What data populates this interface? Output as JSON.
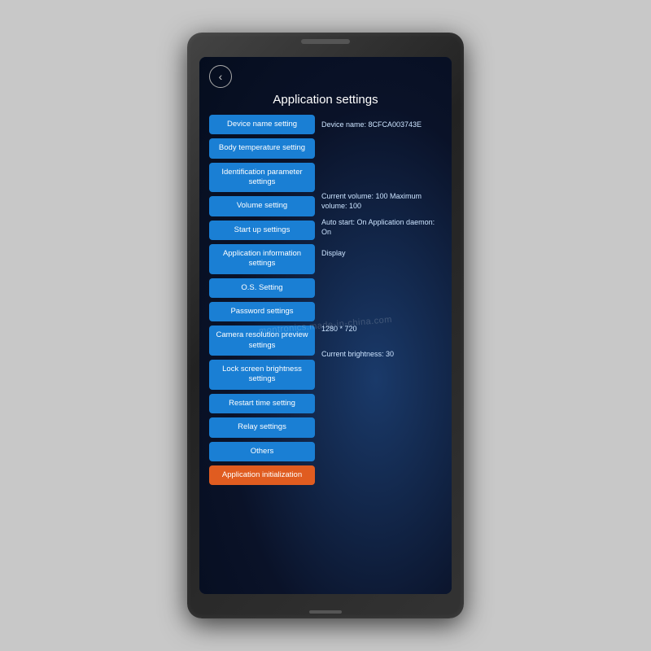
{
  "device": {
    "label": "tablet-device"
  },
  "screen": {
    "title": "Application settings",
    "back_icon": "‹",
    "watermark": "montronics.made-in-china.com"
  },
  "buttons": [
    {
      "id": "device-name-setting",
      "label": "Device name setting",
      "variant": "blue"
    },
    {
      "id": "body-temp-setting",
      "label": "Body temperature setting",
      "variant": "blue"
    },
    {
      "id": "identification-param",
      "label": "Identification parameter settings",
      "variant": "blue"
    },
    {
      "id": "volume-setting",
      "label": "Volume setting",
      "variant": "blue"
    },
    {
      "id": "startup-settings",
      "label": "Start up settings",
      "variant": "blue"
    },
    {
      "id": "app-info-settings",
      "label": "Application information settings",
      "variant": "blue"
    },
    {
      "id": "os-setting",
      "label": "O.S. Setting",
      "variant": "blue"
    },
    {
      "id": "password-settings",
      "label": "Password settings",
      "variant": "blue"
    },
    {
      "id": "camera-resolution",
      "label": "Camera resolution preview settings",
      "variant": "blue"
    },
    {
      "id": "lock-screen-brightness",
      "label": "Lock screen brightness settings",
      "variant": "blue"
    },
    {
      "id": "restart-time",
      "label": "Restart time setting",
      "variant": "blue"
    },
    {
      "id": "relay-settings",
      "label": "Relay settings",
      "variant": "blue"
    },
    {
      "id": "others",
      "label": "Others",
      "variant": "blue"
    },
    {
      "id": "app-initialization",
      "label": "Application initialization",
      "variant": "orange"
    }
  ],
  "info_rows": [
    {
      "id": "device-name-info",
      "text": "Device name: 8CFCA003743E"
    },
    {
      "id": "body-temp-info",
      "text": ""
    },
    {
      "id": "identification-info",
      "text": ""
    },
    {
      "id": "volume-info",
      "text": "Current volume: 100     Maximum volume: 100"
    },
    {
      "id": "startup-info",
      "text": "Auto start: On     Application  daemon: On"
    },
    {
      "id": "app-info-display",
      "text": "Display"
    },
    {
      "id": "os-info",
      "text": ""
    },
    {
      "id": "password-info",
      "text": ""
    },
    {
      "id": "camera-info",
      "text": "1280 * 720"
    },
    {
      "id": "brightness-info",
      "text": "Current brightness: 30"
    },
    {
      "id": "restart-info",
      "text": ""
    },
    {
      "id": "relay-info",
      "text": ""
    },
    {
      "id": "others-info",
      "text": ""
    },
    {
      "id": "init-info",
      "text": ""
    }
  ]
}
